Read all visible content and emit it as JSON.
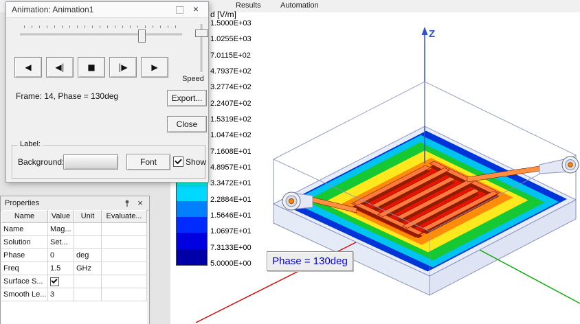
{
  "menu": {
    "items": [
      {
        "label": "Results"
      },
      {
        "label": "Automation"
      }
    ]
  },
  "animation_dialog": {
    "title": "Animation: Animation1",
    "frame_info": "Frame: 14, Phase = 130deg",
    "speed_label": "Speed",
    "export_button": "Export...",
    "close_button": "Close",
    "transport": [
      {
        "name": "play-reverse",
        "glyph": "◀"
      },
      {
        "name": "step-back",
        "glyph": "◀|"
      },
      {
        "name": "stop",
        "glyph": "■"
      },
      {
        "name": "step-forward",
        "glyph": "|▶"
      },
      {
        "name": "play-forward",
        "glyph": "▶"
      }
    ],
    "label_group": {
      "title": "Label:",
      "background_label": "Background:",
      "font_button": "Font",
      "show_label": "Show",
      "show_checked": true
    },
    "icons": {
      "close": "×"
    }
  },
  "properties": {
    "title": "Properties",
    "columns": [
      "Name",
      "Value",
      "Unit",
      "Evaluate..."
    ],
    "rows": [
      {
        "name": "Name",
        "value": "Mag...",
        "unit": ""
      },
      {
        "name": "Solution",
        "value": "Set...",
        "unit": ""
      },
      {
        "name": "Phase",
        "value": "0",
        "unit": "deg"
      },
      {
        "name": "Freq",
        "value": "1.5",
        "unit": "GHz"
      },
      {
        "name": "Surface S...",
        "value": "",
        "unit": "",
        "checkbox": true,
        "checked": true
      },
      {
        "name": "Smooth Le...",
        "value": "3",
        "unit": ""
      }
    ]
  },
  "legend": {
    "title": "d [V/m]",
    "values": [
      "1.5000E+03",
      "1.0255E+03",
      "7.0115E+02",
      "4.7937E+02",
      "3.2774E+02",
      "2.2407E+02",
      "1.5319E+02",
      "1.0474E+02",
      "7.1608E+01",
      "4.8957E+01",
      "3.3472E+01",
      "2.2884E+01",
      "1.5646E+01",
      "1.0697E+01",
      "7.3133E+00",
      "5.0000E+00"
    ],
    "segment_colors": [
      "#ff0000",
      "#ff5100",
      "#ff9d00",
      "#ffe100",
      "#d4ff00",
      "#88ff00",
      "#3cff00",
      "#00ff22",
      "#00ff80",
      "#00ffd9",
      "#00d9ff",
      "#0080ff",
      "#002bff",
      "#0000e0",
      "#0000a8"
    ]
  },
  "viewport": {
    "z_axis_label": "Z",
    "phase_annotation": "Phase = 130deg",
    "phase_color": "#0000e0",
    "x_axis_color": "#dd0000",
    "y_axis_color": "#00aa00",
    "z_axis_color": "#3050cc"
  }
}
